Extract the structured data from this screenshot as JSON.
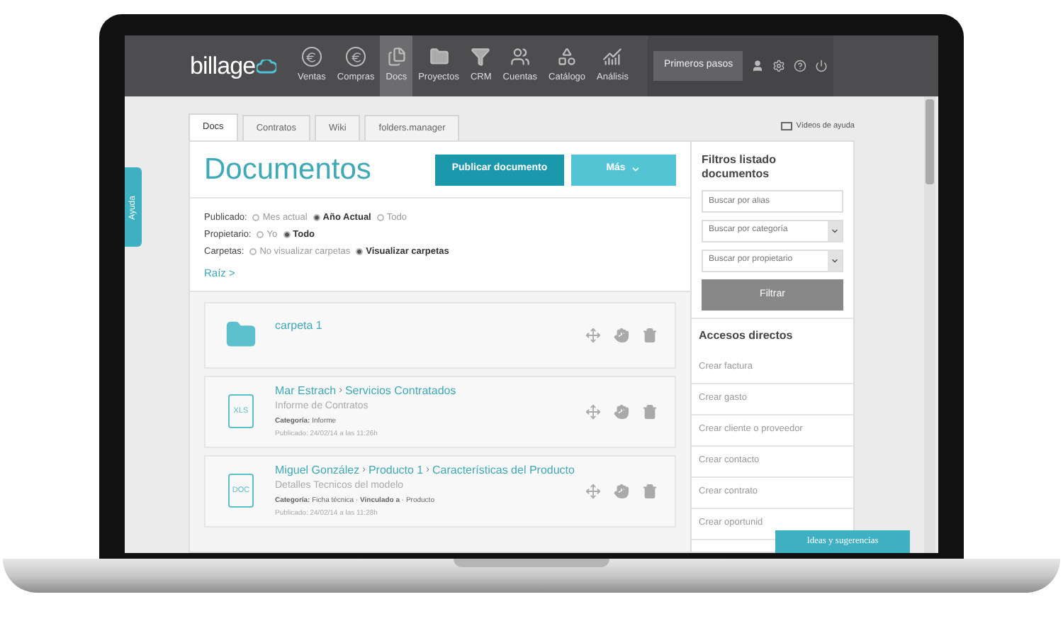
{
  "side_tab": "Ayuda",
  "nav": {
    "logo": "billage",
    "items": [
      {
        "label": "Ventas",
        "selected": false
      },
      {
        "label": "Compras",
        "selected": false
      },
      {
        "label": "Docs",
        "selected": true
      },
      {
        "label": "Proyectos",
        "selected": false
      },
      {
        "label": "CRM",
        "selected": false
      },
      {
        "label": "Cuentas",
        "selected": false
      },
      {
        "label": "Catálogo",
        "selected": false
      },
      {
        "label": "Análisis",
        "selected": false
      }
    ],
    "primary_button": "Primeros pasos"
  },
  "tabs": [
    {
      "label": "Docs",
      "selected": true
    },
    {
      "label": "Contratos",
      "selected": false
    },
    {
      "label": "Wiki",
      "selected": false
    },
    {
      "label": "folders.manager",
      "selected": false
    }
  ],
  "help_link": "Vídeos de ayuda",
  "title": "Documentos",
  "publish_button": "Publicar documento",
  "more_button": "Más",
  "filters": [
    {
      "label": "Publicado:",
      "options": [
        {
          "label": "Mes actual",
          "selected": false
        },
        {
          "label": "Año Actual",
          "selected": true
        },
        {
          "label": "Todo",
          "selected": false
        }
      ]
    },
    {
      "label": "Propietario:",
      "options": [
        {
          "label": "Yo",
          "selected": false
        },
        {
          "label": "Todo",
          "selected": true
        }
      ]
    },
    {
      "label": "Carpetas:",
      "options": [
        {
          "label": "No visualizar carpetas",
          "selected": false
        },
        {
          "label": "Visualizar carpetas",
          "selected": true
        }
      ]
    }
  ],
  "breadcrumb": "Raíz >",
  "separator": "›",
  "items": [
    {
      "kind": "folder",
      "path": [
        "carpeta 1"
      ]
    },
    {
      "kind": "file",
      "file_type": "XLS",
      "path": [
        "Mar Estrach",
        "Servicios Contratados"
      ],
      "subtitle": "Informe de Contratos",
      "category": "**Categoría:** Informe",
      "published": "Publicado: 24/02/14 a las 11:26h"
    },
    {
      "kind": "file",
      "file_type": "DOC",
      "path": [
        "Miguel González",
        "Producto 1",
        "Características del Producto"
      ],
      "subtitle": "Detalles Tecnicos del modelo",
      "category": "**Categoría:** Ficha técnica · **Vinculado a** · Producto",
      "published": "Publicado: 24/02/14 a las 11:28h"
    }
  ],
  "sidebar": {
    "heading": "Filtros listado documentos",
    "search": {
      "placeholder": "Buscar por alias"
    },
    "selects": [
      {
        "placeholder": "Buscar por categoría"
      },
      {
        "placeholder": "Buscar por propietario"
      }
    ],
    "filter_button": "Filtrar",
    "shortcuts_heading": "Accesos directos",
    "shortcuts": [
      "Crear factura",
      "Crear gasto",
      "Crear cliente o proveedor",
      "Crear contacto",
      "Crear contrato",
      "Crear oportunid"
    ]
  },
  "feedback_button": "Ideas y sugerencias"
}
